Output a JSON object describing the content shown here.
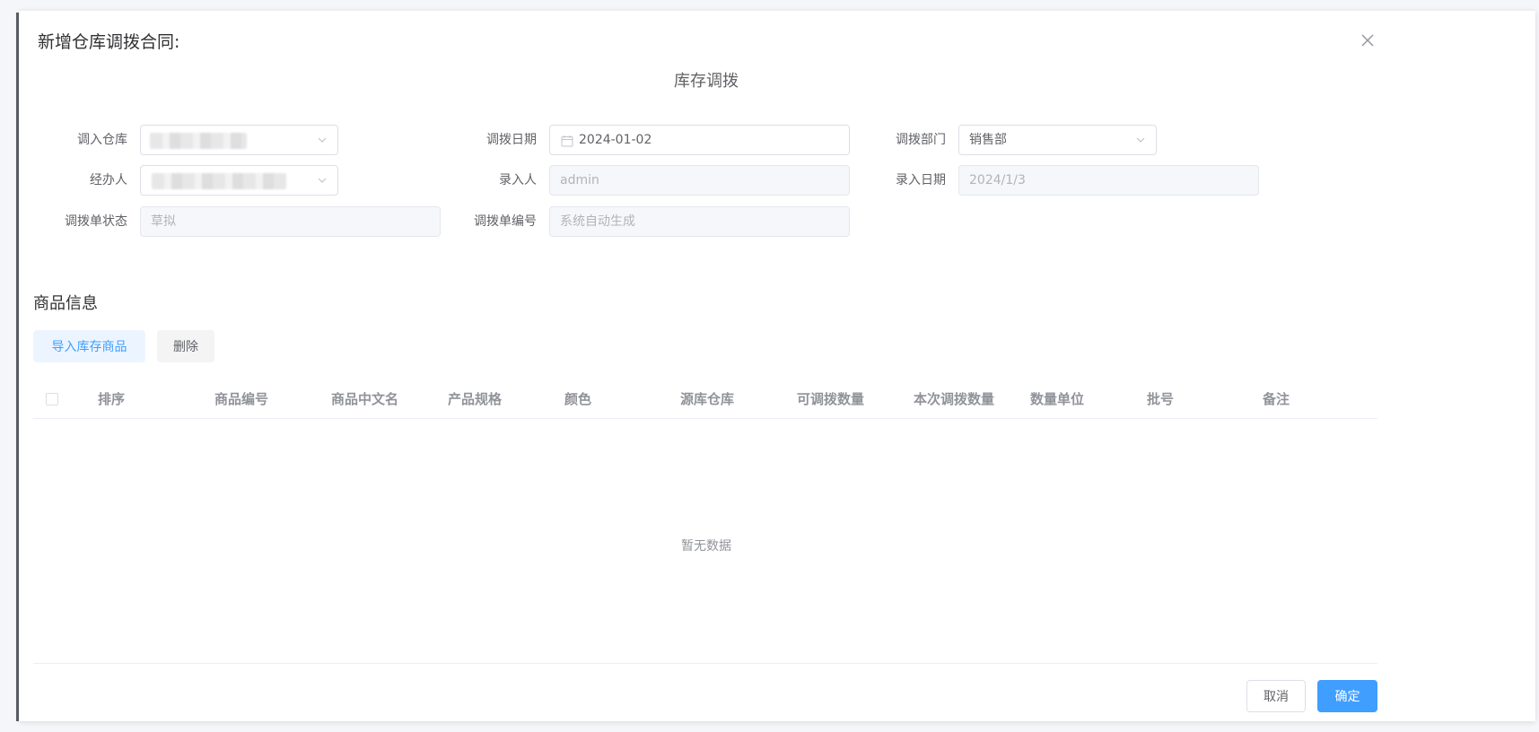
{
  "dialog": {
    "title": "新增仓库调拨合同:",
    "section_title": "库存调拨"
  },
  "form": {
    "in_warehouse": {
      "label": "调入仓库",
      "value": ""
    },
    "transfer_date": {
      "label": "调拨日期",
      "value": "2024-01-02"
    },
    "department": {
      "label": "调拨部门",
      "value": "销售部"
    },
    "handler": {
      "label": "经办人",
      "value": ""
    },
    "entered_by": {
      "label": "录入人",
      "value": "admin"
    },
    "entry_date": {
      "label": "录入日期",
      "value": "2024/1/3"
    },
    "status": {
      "label": "调拨单状态",
      "value": "草拟"
    },
    "order_no": {
      "label": "调拨单编号",
      "value": "系统自动生成"
    }
  },
  "goods": {
    "title": "商品信息",
    "import_label": "导入库存商品",
    "delete_label": "删除"
  },
  "table": {
    "columns": [
      "排序",
      "商品编号",
      "商品中文名",
      "产品规格",
      "颜色",
      "源库仓库",
      "可调拨数量",
      "本次调拨数量",
      "数量单位",
      "批号",
      "备注"
    ],
    "empty_text": "暂无数据"
  },
  "footer": {
    "cancel_label": "取消",
    "confirm_label": "确定"
  },
  "icons": {
    "close": "close-icon",
    "calendar": "calendar-icon",
    "dropdown": "chevron-down-icon"
  },
  "colors": {
    "primary": "#409eff",
    "primary_light": "#ecf5ff"
  }
}
